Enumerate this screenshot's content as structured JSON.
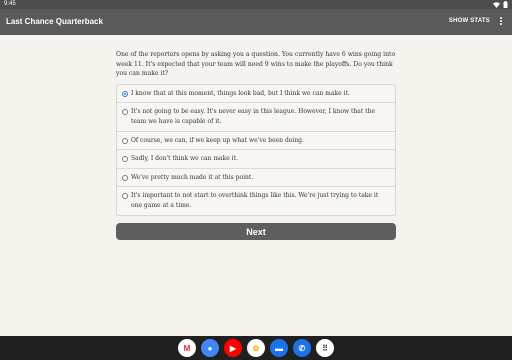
{
  "status": {
    "time": "9:45"
  },
  "app_bar": {
    "title": "Last Chance Quarterback",
    "show_stats_label": "SHOW STATS"
  },
  "question": "One of the reporters opens by asking you a question. You currently have 6 wins going into week 11. It's expected that your team will need 9 wins to make the playoffs. Do you think you can make it?",
  "options": [
    {
      "label": "I know that at this moment, things look bad, but I think we can make it.",
      "selected": true
    },
    {
      "label": "It's not going to be easy. It's never easy in this league. However, I know that the team we have is capable of it.",
      "selected": false
    },
    {
      "label": "Of course, we can, if we keep up what we've been doing.",
      "selected": false
    },
    {
      "label": "Sadly, I don't think we can make it.",
      "selected": false
    },
    {
      "label": "We've pretty much made it at this point.",
      "selected": false
    },
    {
      "label": "It's important to not start to overthink things like this. We're just trying to take it one game at a time.",
      "selected": false
    }
  ],
  "next_label": "Next",
  "dock": [
    {
      "name": "gmail-icon",
      "glyph": "M",
      "bg": "#ffffff",
      "fg": "#d93025"
    },
    {
      "name": "chrome-icon",
      "glyph": "●",
      "bg": "#4285f4",
      "fg": "#ffffff"
    },
    {
      "name": "youtube-icon",
      "glyph": "▶",
      "bg": "#ff0000",
      "fg": "#ffffff"
    },
    {
      "name": "photos-icon",
      "glyph": "✿",
      "bg": "#ffffff",
      "fg": "#fbbc04"
    },
    {
      "name": "messages-icon",
      "glyph": "▬",
      "bg": "#1a73e8",
      "fg": "#ffffff"
    },
    {
      "name": "phone-icon",
      "glyph": "✆",
      "bg": "#1a73e8",
      "fg": "#ffffff"
    },
    {
      "name": "app-drawer-icon",
      "glyph": "⠿",
      "bg": "#ffffff",
      "fg": "#444444"
    }
  ]
}
